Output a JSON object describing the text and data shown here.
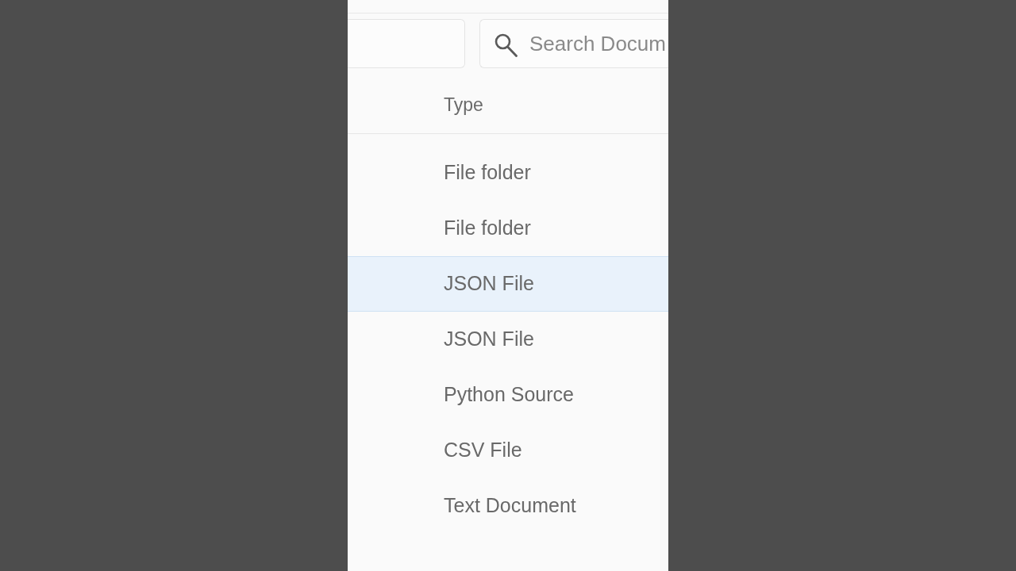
{
  "search": {
    "placeholder": "Search Docum"
  },
  "table": {
    "columns": [
      "Type"
    ],
    "rows": [
      {
        "type": "File folder",
        "selected": false
      },
      {
        "type": "File folder",
        "selected": false
      },
      {
        "type": "JSON File",
        "selected": true
      },
      {
        "type": "JSON File",
        "selected": false
      },
      {
        "type": "Python Source",
        "selected": false
      },
      {
        "type": "CSV File",
        "selected": false
      },
      {
        "type": "Text Document",
        "selected": false
      }
    ]
  }
}
